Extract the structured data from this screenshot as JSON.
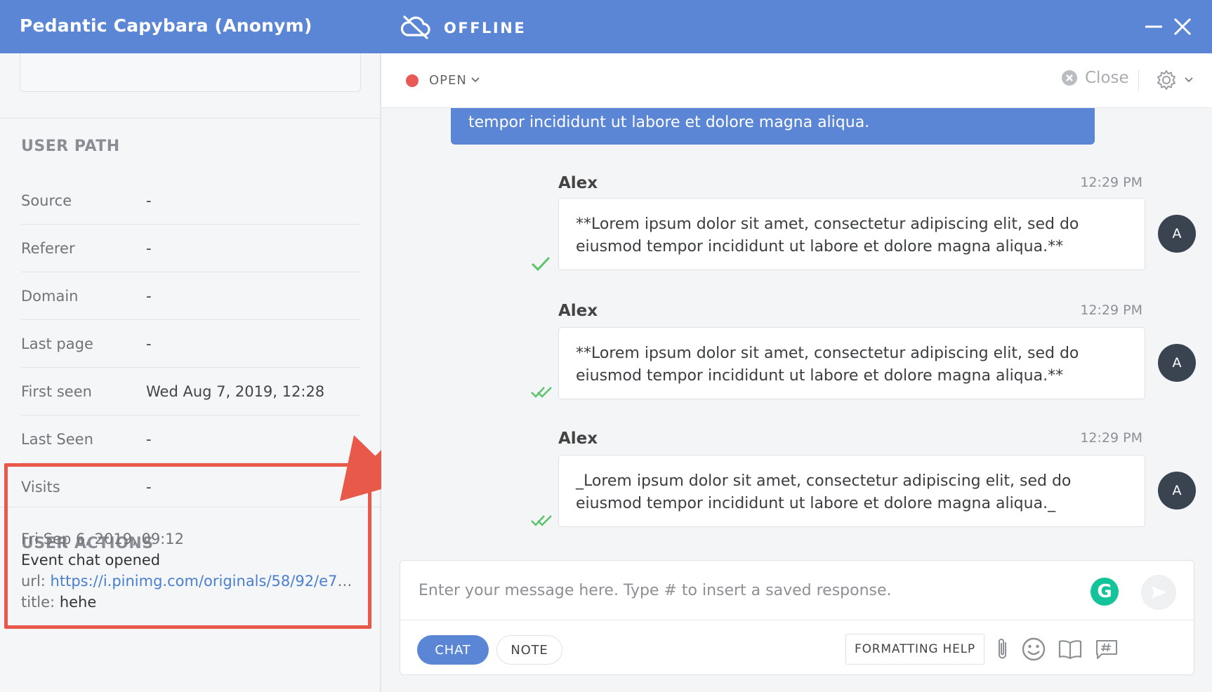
{
  "header": {
    "user_title": "Pedantic Capybara (Anonym)",
    "connection_status": "OFFLINE"
  },
  "user_path": {
    "title": "USER PATH",
    "rows": [
      {
        "key": "Source",
        "value": "-"
      },
      {
        "key": "Referer",
        "value": "-"
      },
      {
        "key": "Domain",
        "value": "-"
      },
      {
        "key": "Last page",
        "value": "-"
      },
      {
        "key": "First seen",
        "value": "Wed Aug 7, 2019, 12:28"
      },
      {
        "key": "Last Seen",
        "value": "-"
      },
      {
        "key": "Visits",
        "value": "-"
      }
    ]
  },
  "user_actions": {
    "title": "USER ACTIONS",
    "date": "Fri Sep 6, 2019, 09:12",
    "event": "Event chat opened",
    "url_label": "url:",
    "url": "https://i.pinimg.com/originals/58/92/e7/5...",
    "title_label": "title:",
    "title_value": "hehe"
  },
  "conversation": {
    "status": "OPEN",
    "close_label": "Close",
    "banner_text": "tempor incididunt ut labore et dolore magna aliqua.",
    "messages": [
      {
        "author": "Alex",
        "time": "12:29 PM",
        "text": "**Lorem ipsum dolor sit amet, consectetur adipiscing elit, sed do eiusmod tempor incididunt ut labore et dolore magna aliqua.**",
        "avatar": "A",
        "receipt": "sent"
      },
      {
        "author": "Alex",
        "time": "12:29 PM",
        "text": "**Lorem ipsum dolor sit amet, consectetur adipiscing elit, sed do eiusmod tempor incididunt ut labore et dolore magna aliqua.**",
        "avatar": "A",
        "receipt": "delivered"
      },
      {
        "author": "Alex",
        "time": "12:29 PM",
        "text": "_Lorem ipsum dolor sit amet, consectetur adipiscing elit, sed do eiusmod tempor incididunt ut labore et dolore magna aliqua._",
        "avatar": "A",
        "receipt": "delivered"
      }
    ]
  },
  "composer": {
    "placeholder": "Enter your message here. Type # to insert a saved response.",
    "tab_chat": "CHAT",
    "tab_note": "NOTE",
    "formatting_help": "FORMATTING HELP",
    "grammarly_letter": "G"
  },
  "icons": {
    "offline": "cloud-offline-icon",
    "minimize": "minimize-icon",
    "close": "close-icon",
    "status_chevron": "chevron-down-icon",
    "close_circle": "close-circle-icon",
    "settings": "gear-icon",
    "send": "send-icon",
    "attach": "paperclip-icon",
    "emoji": "emoji-icon",
    "knowledge": "book-icon",
    "saved_responses": "hashtag-icon"
  },
  "colors": {
    "header": "#5b86d6",
    "status_open": "#e85a55",
    "check_green": "#5cc46a",
    "annotation": "#e8594a",
    "grammarly": "#15c39a"
  }
}
